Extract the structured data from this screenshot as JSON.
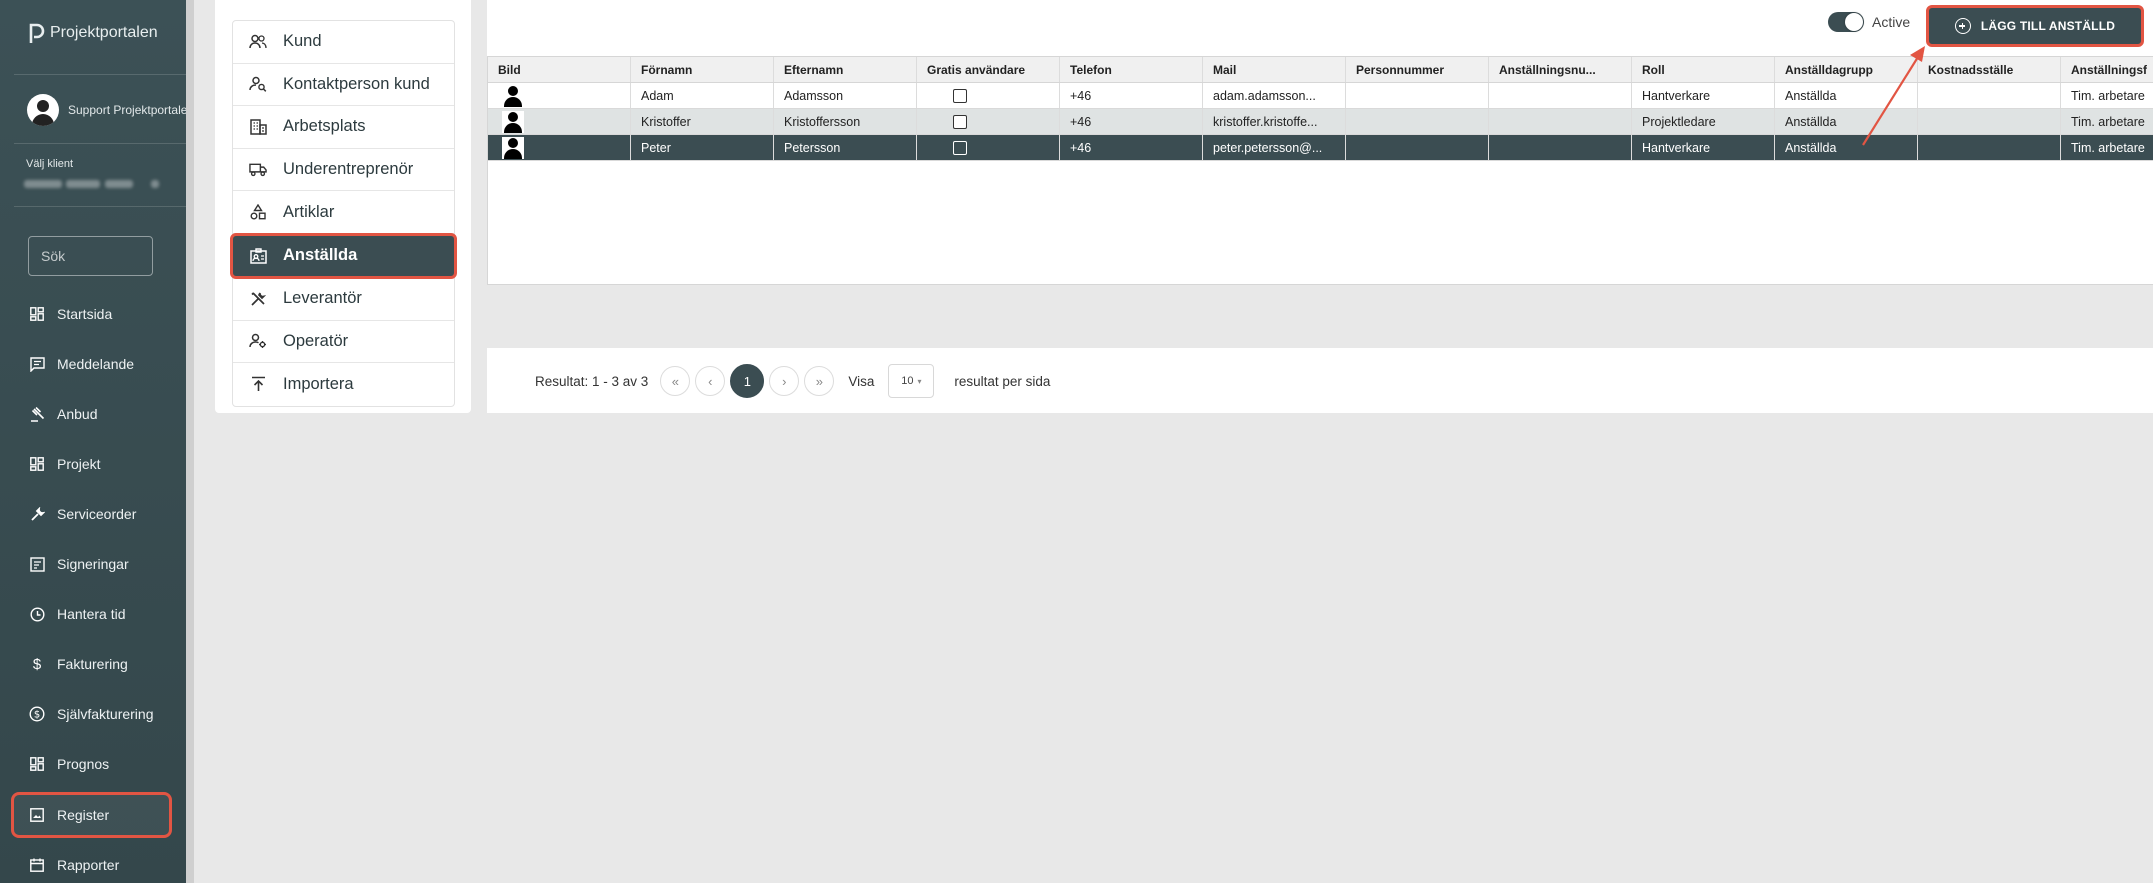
{
  "sidebar": {
    "logo_text": "Projektportalen",
    "user_name": "Support Projektportalen",
    "client_label": "Välj klient",
    "search_placeholder": "Sök",
    "items": [
      {
        "label": "Startsida",
        "icon": "dashboard-icon"
      },
      {
        "label": "Meddelande",
        "icon": "message-icon"
      },
      {
        "label": "Anbud",
        "icon": "gavel-icon"
      },
      {
        "label": "Projekt",
        "icon": "dashboard-icon"
      },
      {
        "label": "Serviceorder",
        "icon": "wrench-icon"
      },
      {
        "label": "Signeringar",
        "icon": "signature-icon"
      },
      {
        "label": "Hantera tid",
        "icon": "clock-icon"
      },
      {
        "label": "Fakturering",
        "icon": "dollar-icon"
      },
      {
        "label": "Självfakturering",
        "icon": "dollar-circle-icon"
      },
      {
        "label": "Prognos",
        "icon": "dashboard-icon"
      },
      {
        "label": "Register",
        "icon": "image-icon"
      },
      {
        "label": "Rapporter",
        "icon": "calendar-icon"
      }
    ]
  },
  "settings": {
    "items": [
      {
        "label": "Kund",
        "icon": "people-icon"
      },
      {
        "label": "Kontaktperson kund",
        "icon": "person-search-icon"
      },
      {
        "label": "Arbetsplats",
        "icon": "building-icon"
      },
      {
        "label": "Underentreprenör",
        "icon": "truck-icon"
      },
      {
        "label": "Artiklar",
        "icon": "shapes-icon"
      },
      {
        "label": "Anställda",
        "icon": "badge-icon"
      },
      {
        "label": "Leverantör",
        "icon": "tools-icon"
      },
      {
        "label": "Operatör",
        "icon": "person-gear-icon"
      },
      {
        "label": "Importera",
        "icon": "upload-icon"
      }
    ]
  },
  "toolbar": {
    "toggle_label": "Active",
    "add_button_label": "LÄGG TILL ANSTÄLLD"
  },
  "table": {
    "headers": [
      "Bild",
      "Förnamn",
      "Efternamn",
      "Gratis användare",
      "Telefon",
      "Mail",
      "Personnummer",
      "Anställningsnu...",
      "Roll",
      "Anställdagrupp",
      "Kostnadsställe",
      "Anställningsfo"
    ],
    "rows": [
      {
        "first": "Adam",
        "last": "Adamsson",
        "phone": "+46",
        "mail": "adam.adamsson...",
        "pnr": "",
        "empno": "",
        "role": "Hantverkare",
        "group": "Anställda",
        "cost": "",
        "form": "Tim. arbetare"
      },
      {
        "first": "Kristoffer",
        "last": "Kristoffersson",
        "phone": "+46",
        "mail": "kristoffer.kristoffe...",
        "pnr": "",
        "empno": "",
        "role": "Projektledare",
        "group": "Anställda",
        "cost": "",
        "form": "Tim. arbetare"
      },
      {
        "first": "Peter",
        "last": "Petersson",
        "phone": "+46",
        "mail": "peter.petersson@...",
        "pnr": "",
        "empno": "",
        "role": "Hantverkare",
        "group": "Anställda",
        "cost": "",
        "form": "Tim. arbetare"
      }
    ]
  },
  "pagination": {
    "result_text": "Resultat: 1 - 3 av 3",
    "first": "«",
    "prev": "‹",
    "current_page": "1",
    "next": "›",
    "last": "»",
    "show_label": "Visa",
    "per_page": "10",
    "per_page_suffix": "resultat per sida"
  },
  "colors": {
    "sidebar_bg": "#3c5156",
    "accent": "#3b4d52",
    "highlight": "#e25543"
  }
}
